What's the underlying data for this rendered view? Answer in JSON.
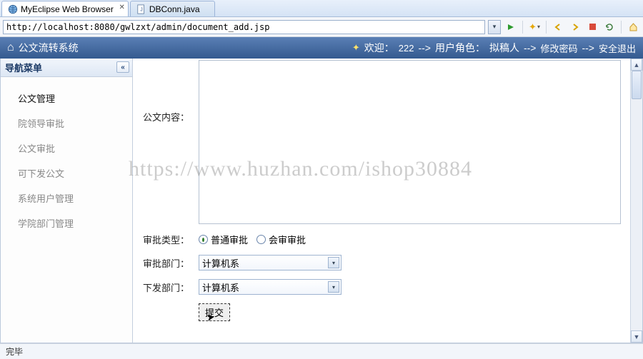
{
  "tabs": {
    "active": {
      "label": "MyEclipse Web Browser"
    },
    "inactive": {
      "label": "DBConn.java"
    }
  },
  "url": "http://localhost:8080/gwlzxt/admin/document_add.jsp",
  "app": {
    "icon_glyph": "⌂",
    "title": "公文流转系统",
    "welcome_prefix": "欢迎：",
    "welcome_user": "222",
    "arrow": "-->",
    "role_label": "用户角色：",
    "role_value": "拟稿人",
    "link_changepwd": "修改密码",
    "link_logout": "安全退出"
  },
  "sidebar": {
    "title": "导航菜单",
    "collapse_glyph": "«",
    "items": [
      {
        "label": "公文管理",
        "active": true
      },
      {
        "label": "院领导审批",
        "active": false
      },
      {
        "label": "公文审批",
        "active": false
      },
      {
        "label": "可下发公文",
        "active": false
      },
      {
        "label": "系统用户管理",
        "active": false
      },
      {
        "label": "学院部门管理",
        "active": false
      }
    ]
  },
  "form": {
    "content_label": "公文内容：",
    "type_label": "审批类型：",
    "type_opt1": "普通审批",
    "type_opt2": "会审审批",
    "dept1_label": "审批部门：",
    "dept1_value": "计算机系",
    "dept2_label": "下发部门：",
    "dept2_value": "计算机系",
    "submit_label": "提交"
  },
  "status": {
    "text": "完毕"
  },
  "watermark": "https://www.huzhan.com/ishop30884"
}
